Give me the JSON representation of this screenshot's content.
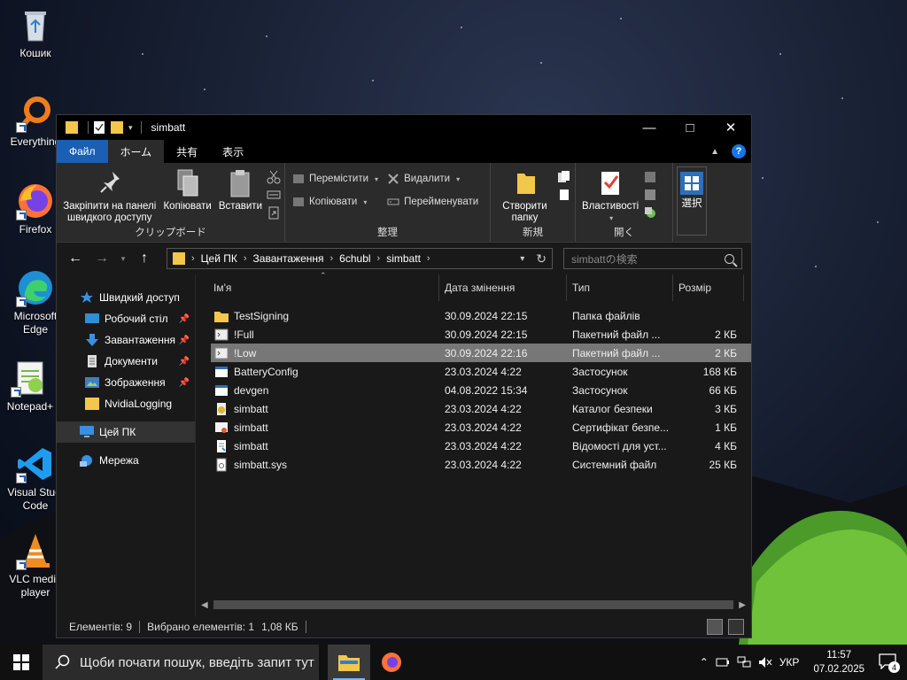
{
  "desktop": {
    "icons": [
      {
        "label": "Кошик"
      },
      {
        "label": "Everything"
      },
      {
        "label": "Firefox"
      },
      {
        "label": "Microsoft Edge"
      },
      {
        "label": "Notepad+"
      },
      {
        "label": "Visual Studi Code"
      },
      {
        "label": "VLC media player"
      }
    ]
  },
  "window": {
    "title": "simbatt",
    "tabs": {
      "file": "Файл",
      "home": "ホーム",
      "share": "共有",
      "view": "表示"
    },
    "ribbon": {
      "clipboard": {
        "pin": "Закріпити на панелі швидкого доступу",
        "copy": "Копіювати",
        "paste": "Вставити",
        "label": "クリップボード"
      },
      "organize": {
        "move": "Перемістити",
        "copy_to": "Копіювати",
        "delete": "Видалити",
        "rename": "Перейменувати",
        "label": "整理"
      },
      "new": {
        "new_folder": "Створити папку",
        "label": "新規"
      },
      "open": {
        "properties": "Властивості",
        "label": "開く"
      },
      "select": {
        "select": "選択"
      }
    },
    "address": {
      "crumbs": [
        "Цей ПК",
        "Завантаження",
        "6chubl",
        "simbatt"
      ],
      "search_placeholder": "simbattの検索"
    },
    "nav": {
      "quick_access": "Швидкий доступ",
      "items": [
        {
          "label": "Робочий стіл",
          "pinned": true
        },
        {
          "label": "Завантаження",
          "pinned": true
        },
        {
          "label": "Документи",
          "pinned": true
        },
        {
          "label": "Зображення",
          "pinned": true
        },
        {
          "label": "NvidiaLogging",
          "pinned": false
        }
      ],
      "this_pc": "Цей ПК",
      "network": "Мережа"
    },
    "columns": {
      "name": "Ім'я",
      "date": "Дата змінення",
      "type": "Тип",
      "size": "Розмір"
    },
    "files": [
      {
        "name": "TestSigning",
        "date": "30.09.2024 22:15",
        "type": "Папка файлів",
        "size": "",
        "icon": "folder-icon"
      },
      {
        "name": "!Full",
        "date": "30.09.2024 22:15",
        "type": "Пакетний файл ...",
        "size": "2 КБ",
        "icon": "batch-file-icon"
      },
      {
        "name": "!Low",
        "date": "30.09.2024 22:16",
        "type": "Пакетний файл ...",
        "size": "2 КБ",
        "icon": "batch-file-icon"
      },
      {
        "name": "BatteryConfig",
        "date": "23.03.2024 4:22",
        "type": "Застосунок",
        "size": "168 КБ",
        "icon": "app-icon"
      },
      {
        "name": "devgen",
        "date": "04.08.2022 15:34",
        "type": "Застосунок",
        "size": "66 КБ",
        "icon": "app-icon"
      },
      {
        "name": "simbatt",
        "date": "23.03.2024 4:22",
        "type": "Каталог безпеки",
        "size": "3 КБ",
        "icon": "catalog-icon"
      },
      {
        "name": "simbatt",
        "date": "23.03.2024 4:22",
        "type": "Сертифікат безпе...",
        "size": "1 КБ",
        "icon": "certificate-icon"
      },
      {
        "name": "simbatt",
        "date": "23.03.2024 4:22",
        "type": "Відомості для уст...",
        "size": "4 КБ",
        "icon": "setup-info-icon"
      },
      {
        "name": "simbatt.sys",
        "date": "23.03.2024 4:22",
        "type": "Системний файл",
        "size": "25 КБ",
        "icon": "system-file-icon"
      }
    ],
    "selected_index": 2,
    "status": {
      "items": "Елементів: 9",
      "selected": "Вибрано елементів: 1",
      "size": "1,08 КБ"
    }
  },
  "taskbar": {
    "search_placeholder": "Щоби почати пошук, введіть запит тут",
    "lang": "УКР",
    "time": "11:57",
    "date": "07.02.2025",
    "notifications": "4"
  },
  "colors": {
    "file_tab": "#1a5fb4",
    "accent_folder": "#f3c64c",
    "selection": "#777777"
  }
}
